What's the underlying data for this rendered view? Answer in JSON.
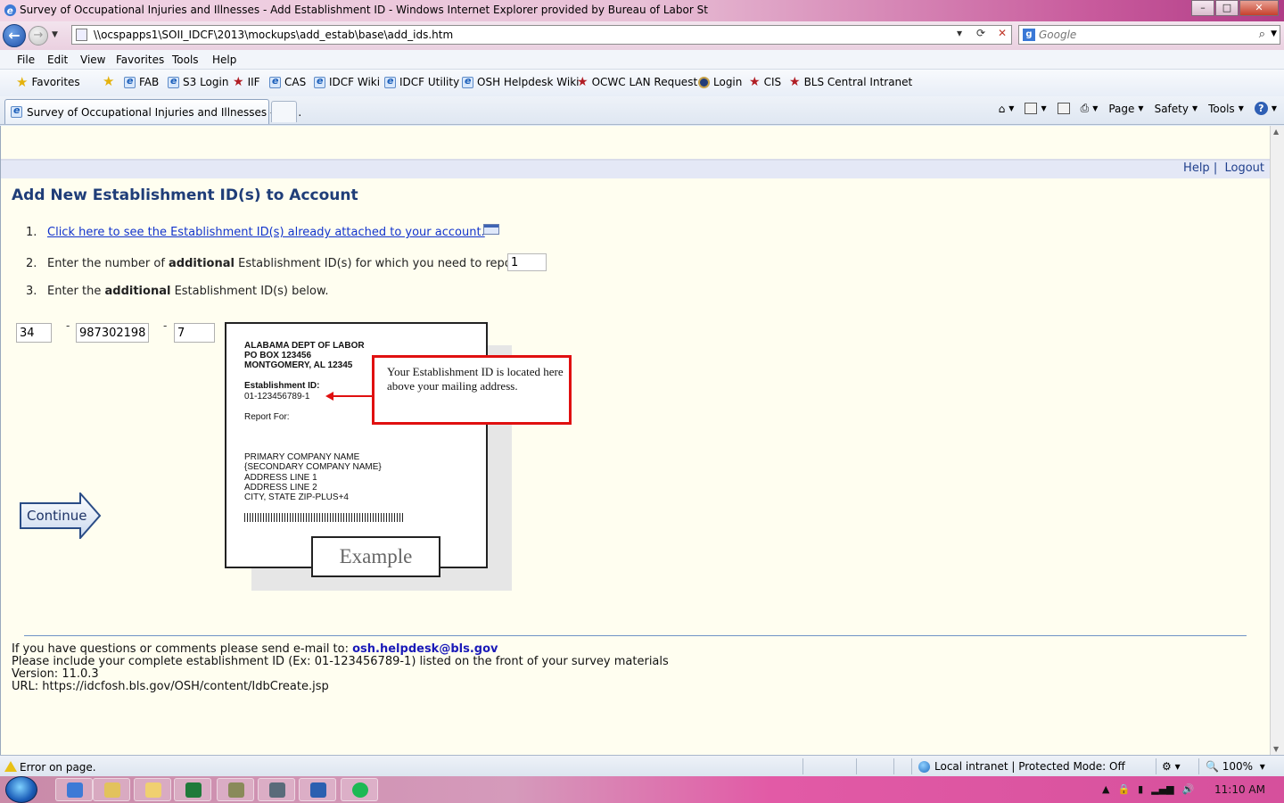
{
  "window": {
    "title": "Survey of Occupational Injuries and Illnesses - Add Establishment ID - Windows Internet Explorer provided by Bureau of Labor St",
    "controls": [
      "–",
      "□",
      "✕"
    ]
  },
  "address_bar": {
    "url": "\\\\ocspapps1\\SOII_IDCF\\2013\\mockups\\add_estab\\base\\add_ids.htm"
  },
  "search": {
    "placeholder": "Google"
  },
  "menu": [
    "File",
    "Edit",
    "View",
    "Favorites",
    "Tools",
    "Help"
  ],
  "favorites_bar": {
    "favorites_label": "Favorites",
    "items": [
      {
        "label": "FAB",
        "icon": "ie-page-icon"
      },
      {
        "label": "S3 Login",
        "icon": "ie-page-icon"
      },
      {
        "label": "IIF",
        "icon": "red-star-icon"
      },
      {
        "label": "CAS",
        "icon": "ie-page-icon"
      },
      {
        "label": "IDCF Wiki",
        "icon": "ie-page-icon"
      },
      {
        "label": "IDCF Utility",
        "icon": "ie-page-icon"
      },
      {
        "label": "OSH Helpdesk Wiki",
        "icon": "ie-page-icon"
      },
      {
        "label": "OCWC LAN Request",
        "icon": "red-star-icon"
      },
      {
        "label": "Login",
        "icon": "seal-icon"
      },
      {
        "label": "CIS",
        "icon": "red-star-icon"
      },
      {
        "label": "BLS Central Intranet",
        "icon": "red-star-icon"
      }
    ]
  },
  "tab": {
    "label": "Survey of Occupational Injuries and Illnesses - Ad..."
  },
  "command_bar": {
    "page": "Page",
    "safety": "Safety",
    "tools": "Tools"
  },
  "page": {
    "help_link": "Help",
    "separator": "|",
    "logout_link": "Logout",
    "title": "Add New Establishment ID(s) to Account",
    "step1": {
      "num": "1.",
      "link": "Click here to see the Establishment ID(s) already attached to your account."
    },
    "step2": {
      "num": "2.",
      "pre": "Enter the number of ",
      "bold": "additional",
      "post": " Establishment ID(s) for which you need to report.",
      "value": "1"
    },
    "step3": {
      "num": "3.",
      "pre": "Enter the ",
      "bold": "additional",
      "post": " Establishment ID(s) below."
    },
    "id_fields": {
      "part1": "34",
      "part2": "987302198",
      "part3": "7",
      "dash": "-"
    },
    "continue_label": "Continue",
    "example": {
      "org_line1": "ALABAMA DEPT OF LABOR",
      "org_line2": "PO BOX 123456",
      "org_line3": "MONTGOMERY, AL 12345",
      "id_label": "Establishment ID:",
      "id_value": "01-123456789-1",
      "report_for": "Report For:",
      "addr1": "PRIMARY COMPANY NAME",
      "addr2": "{SECONDARY COMPANY NAME}",
      "addr3": "ADDRESS LINE 1",
      "addr4": "ADDRESS LINE 2",
      "addr5": "CITY, STATE  ZIP-PLUS+4",
      "stamp": "Example",
      "callout": "Your Establishment ID is located here above your mailing address."
    },
    "footer": {
      "line1_pre": "If you have questions or comments please send e-mail to: ",
      "email": "osh.helpdesk@bls.gov",
      "line2": "Please include your complete establishment ID (Ex: 01-123456789-1) listed on the front of your survey materials",
      "line3": "Version: 11.0.3",
      "line4": "URL: https://idcfosh.bls.gov/OSH/content/IdbCreate.jsp"
    }
  },
  "status_bar": {
    "message": "Error on page.",
    "zone": "Local intranet | Protected Mode: Off",
    "zoom": "100%"
  },
  "taskbar": {
    "apps": [
      "internet-explorer",
      "windows-explorer",
      "outlook",
      "excel",
      "app-5",
      "app-6",
      "word",
      "spotify"
    ],
    "clock": "11:10 AM"
  },
  "colors": {
    "page_bg": "#fffef0",
    "title": "#1f3d78",
    "link": "#1133cc",
    "callout_border": "#e01010",
    "email": "#1a1ab8"
  }
}
